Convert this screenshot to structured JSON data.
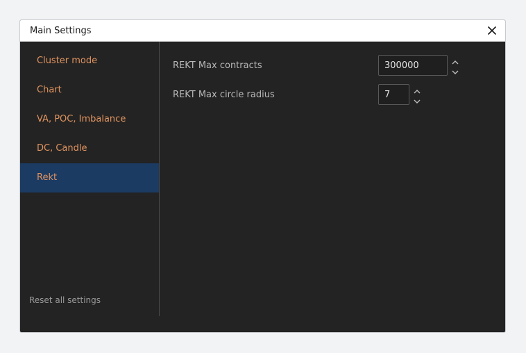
{
  "dialog": {
    "title": "Main Settings",
    "close_icon": "close-x-icon"
  },
  "sidebar": {
    "items": [
      {
        "label": "Cluster mode",
        "active": false
      },
      {
        "label": "Chart",
        "active": false
      },
      {
        "label": "VA, POC, Imbalance",
        "active": false
      },
      {
        "label": "DC, Candle",
        "active": false
      },
      {
        "label": "Rekt",
        "active": true
      }
    ],
    "reset_label": "Reset all settings"
  },
  "settings": {
    "max_contracts": {
      "label": "REKT Max contracts",
      "value": "300000"
    },
    "max_circle_radius": {
      "label": "REKT Max circle radius",
      "value": "7"
    }
  },
  "colors": {
    "accent_text": "#e0935f",
    "active_bg": "#1c3b63",
    "panel_bg": "#232323"
  }
}
